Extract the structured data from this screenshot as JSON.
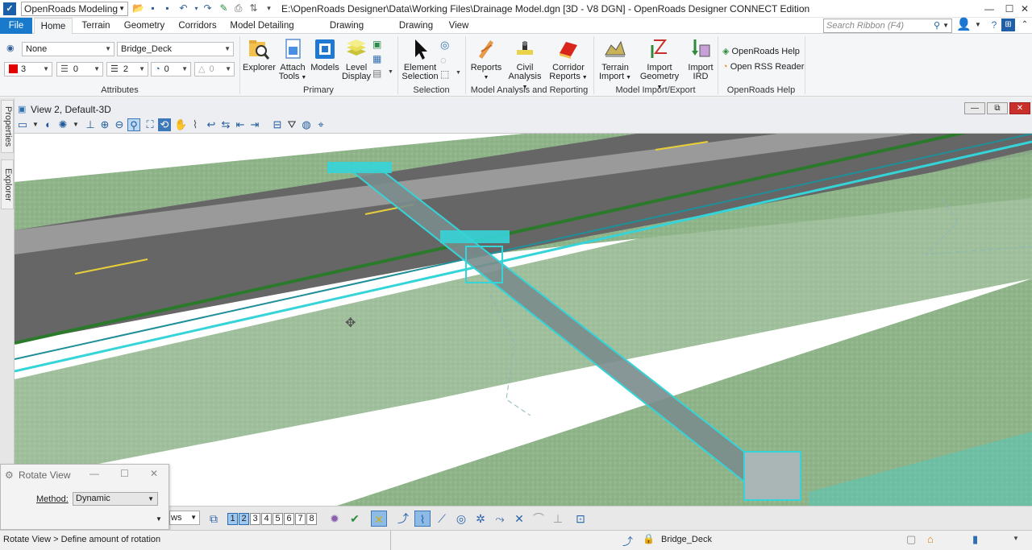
{
  "titlebar": {
    "workflow": "OpenRoads Modeling",
    "title": "E:\\OpenRoads Designer\\Data\\Working Files\\Drainage Model.dgn [3D - V8 DGN] - OpenRoads Designer CONNECT Edition"
  },
  "tabs": [
    "File",
    "Home",
    "Terrain",
    "Geometry",
    "Corridors",
    "Model Detailing",
    "Drawing Production",
    "Drawing",
    "View"
  ],
  "active_tab": "Home",
  "search_ribbon": {
    "placeholder": "Search Ribbon (F4)"
  },
  "attributes": {
    "active_level_display": "None",
    "level": "Bridge_Deck",
    "color": "3",
    "color_hex": "#e00000",
    "line_style": "0",
    "weight": "2",
    "transparency": "0",
    "priority": "0"
  },
  "groups": {
    "attributes": "Attributes",
    "primary": "Primary",
    "selection": "Selection",
    "analysis": "Model Analysis and Reporting",
    "import": "Model Import/Export",
    "help": "OpenRoads Help"
  },
  "buttons": {
    "explorer": "Explorer",
    "attach_tools_1": "Attach",
    "attach_tools_2": "Tools",
    "models": "Models",
    "level_display_1": "Level",
    "level_display_2": "Display",
    "element_selection_1": "Element",
    "element_selection_2": "Selection",
    "reports": "Reports",
    "civil_analysis_1": "Civil",
    "civil_analysis_2": "Analysis",
    "corridor_reports_1": "Corridor",
    "corridor_reports_2": "Reports",
    "terrain_import_1": "Terrain",
    "terrain_import_2": "Import",
    "import_geometry_1": "Import",
    "import_geometry_2": "Geometry",
    "import_ird_1": "Import",
    "import_ird_2": "IRD",
    "openroads_help": "OpenRoads Help",
    "open_rss": "Open RSS Reader"
  },
  "side_tabs": [
    "Properties",
    "Explorer"
  ],
  "view": {
    "title": "View 2, Default-3D"
  },
  "view_numbers": [
    "1",
    "2",
    "3",
    "4",
    "5",
    "6",
    "7",
    "8"
  ],
  "active_views": [
    "1",
    "2"
  ],
  "views_combo_text": "ws",
  "dialog": {
    "title": "Rotate View",
    "method_label": "Method:",
    "method_value": "Dynamic"
  },
  "status": {
    "prompt": "Rotate View > Define amount of rotation",
    "level": "Bridge_Deck"
  },
  "colors": {
    "accent": "#1979ca",
    "terrain": "#8fb48a",
    "pipe": "#35d4d8",
    "road": "#6b6b6b"
  }
}
